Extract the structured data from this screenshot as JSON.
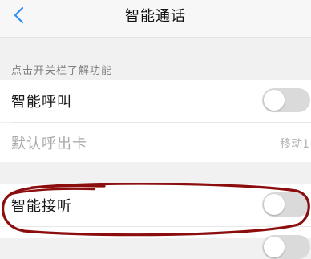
{
  "header": {
    "title": "智能通话",
    "back_icon": "chevron-left-icon"
  },
  "section": {
    "caption": "点击开关栏了解功能"
  },
  "rows": [
    {
      "label": "智能呼叫",
      "toggle_on": false
    },
    {
      "label": "默认呼出卡",
      "value": "移动1",
      "disabled": true
    },
    {
      "label": "智能接听",
      "toggle_on": false
    }
  ],
  "colors": {
    "accent": "#2e8ff0",
    "annotation": "#8b0d0d",
    "toggle_off": "#dadada"
  }
}
